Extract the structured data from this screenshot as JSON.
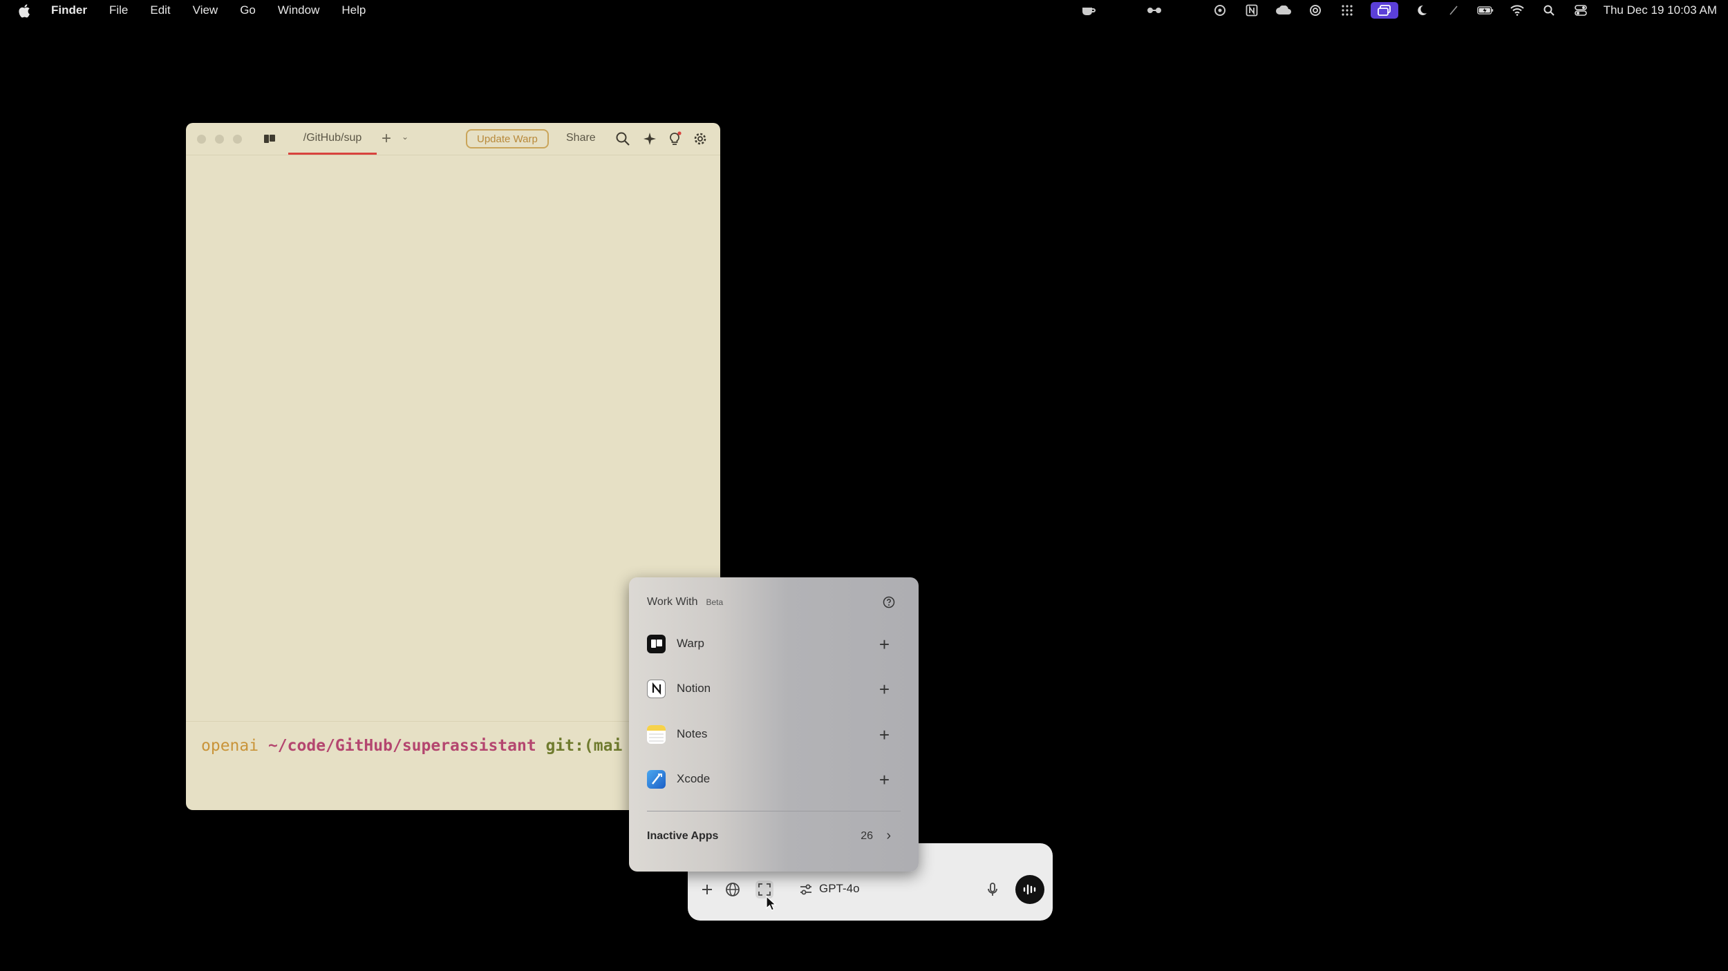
{
  "menubar": {
    "app_name": "Finder",
    "items": [
      "File",
      "Edit",
      "View",
      "Go",
      "Window",
      "Help"
    ],
    "clock": "Thu Dec 19  10:03 AM"
  },
  "warp": {
    "tab_title": "/GitHub/sup",
    "update_label": "Update Warp",
    "share_label": "Share",
    "prompt_user": "openai",
    "prompt_path": "~/code/GitHub/superassistant",
    "prompt_git": "git:(mai"
  },
  "work_with": {
    "title": "Work With",
    "badge": "Beta",
    "apps": [
      {
        "name": "Warp",
        "icon": "warp-icon"
      },
      {
        "name": "Notion",
        "icon": "notion-icon"
      },
      {
        "name": "Notes",
        "icon": "notes-icon"
      },
      {
        "name": "Xcode",
        "icon": "xcode-icon"
      }
    ],
    "inactive_label": "Inactive Apps",
    "inactive_count": "26"
  },
  "composer": {
    "model": "GPT-4o"
  },
  "colors": {
    "warp_bg": "#e6e0c5",
    "accent_tab": "#d9433e",
    "status_active": "#5b3fd8"
  }
}
